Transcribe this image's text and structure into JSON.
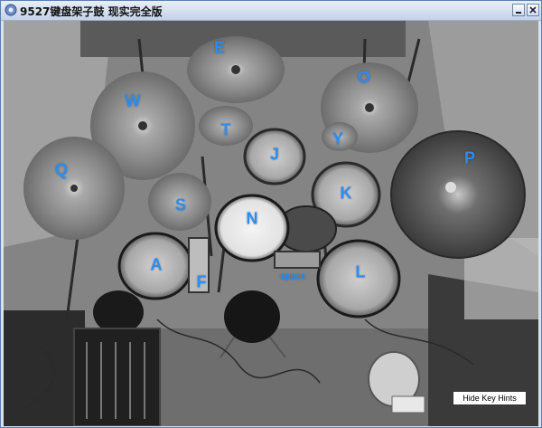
{
  "window": {
    "title": "9527键盘架子鼓 现实完全版",
    "minimize_label": "_",
    "close_label": "X"
  },
  "keys": {
    "E": "E",
    "W": "W",
    "O": "O",
    "Q": "Q",
    "T": "T",
    "J": "J",
    "Y": "Y",
    "P": "P",
    "S": "S",
    "K": "K",
    "N": "N",
    "A": "A",
    "F": "F",
    "L": "L",
    "space": "space"
  },
  "buttons": {
    "hide_hints": "Hide Key Hints"
  },
  "colors": {
    "key_hint": "#2c8df0",
    "titlebar_border": "#5b7fae"
  }
}
